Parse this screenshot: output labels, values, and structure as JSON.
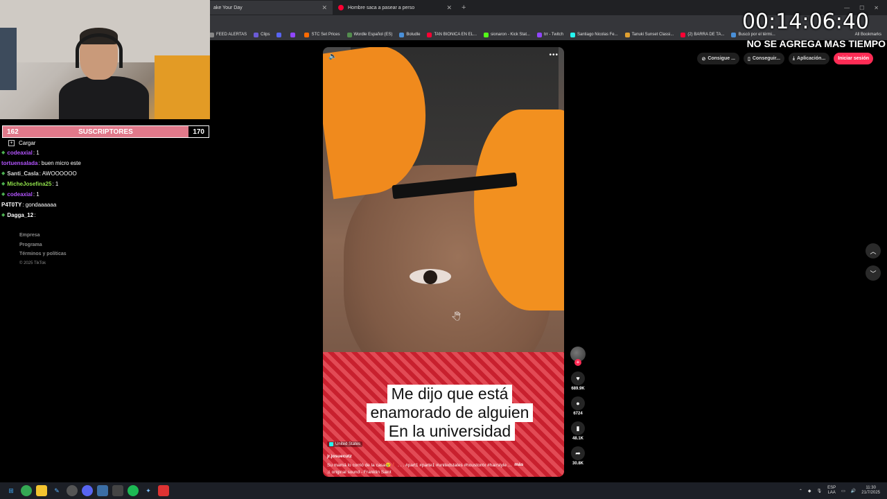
{
  "browser": {
    "tabs": [
      {
        "label": "ake Your Day",
        "active": true
      },
      {
        "label": "Hombre saca a pasear a perso",
        "active": false
      }
    ],
    "bookmarks": [
      {
        "label": "FEED ALERTAS",
        "color": "#888888"
      },
      {
        "label": "Clips",
        "color": "#6b5bd6"
      },
      {
        "label": "",
        "color": "#5865f2"
      },
      {
        "label": "",
        "color": "#9146ff"
      },
      {
        "label": "STC Set Prices",
        "color": "#ff6a00"
      },
      {
        "label": "Wordle Español (ES)",
        "color": "#538d4e"
      },
      {
        "label": "Boludle",
        "color": "#4a90d9"
      },
      {
        "label": "TAN BIONICA EN EL...",
        "color": "#ff0033"
      },
      {
        "label": "sionaron - Kick Stat...",
        "color": "#53fc18"
      },
      {
        "label": "trr - Twitch",
        "color": "#9146ff"
      },
      {
        "label": "Santiago Nicolas Fe...",
        "color": "#25f4ee"
      },
      {
        "label": "Tanuki Sunset Classi...",
        "color": "#e0a030"
      },
      {
        "label": "(2) BARRA DE TA...",
        "color": "#ff0033"
      },
      {
        "label": "Buscó por el térmi...",
        "color": "#4a90d9"
      }
    ],
    "all_bookmarks": "All Bookmarks"
  },
  "overlay": {
    "timer": "00:14:06:40",
    "timer_note": "NO SE AGREGA MAS TIEMPO"
  },
  "subs": {
    "current": "162",
    "label": "SUSCRIPTORES",
    "goal": "170"
  },
  "chat": {
    "load_label": "Cargar",
    "messages": [
      {
        "user": "codeaxial",
        "text": ": 1",
        "color": "#b455ff",
        "diamond": true
      },
      {
        "user": "tortuensalada",
        "text": ": buen micro este",
        "color": "#b455ff",
        "diamond": false
      },
      {
        "user": "Santi_Casla",
        "text": ": AWOOOOOO",
        "color": "#dddddd",
        "diamond": true
      },
      {
        "user": "MicheJosefina25",
        "text": ": 1",
        "color": "#8fe04a",
        "diamond": true
      },
      {
        "user": "codeaxial",
        "text": ": 1",
        "color": "#b455ff",
        "diamond": true
      },
      {
        "user": "P4T0TY",
        "text": ": gondaaaaaa",
        "color": "#ffffff",
        "diamond": false
      },
      {
        "user": "Dagga_12",
        "text": ":",
        "color": "#ffffff",
        "diamond": true
      }
    ]
  },
  "tiktok": {
    "top": {
      "btn1": "Consigue ...",
      "btn2": "Conseguir...",
      "btn3": "Aplicación...",
      "login": "Iniciar sesión"
    },
    "footer": [
      "Empresa",
      "Programa",
      "Términos y políticas"
    ],
    "copyright": "© 2025 TikTok",
    "video": {
      "caption_lines": [
        "Me dijo que está",
        "enamorado de alguien",
        "En la universidad"
      ],
      "location": "United States",
      "username": "jr.josuecutz",
      "description": "Su mamá lo corrió de la casa😢❗ . . . #part1 #parte1 #unitedstates #houstontx #hairstyle ...",
      "more": "más",
      "sound": "♫ original sound - Franklin Saint"
    },
    "actions": {
      "likes": "689.9K",
      "comments": "6724",
      "saves": "48.1K",
      "shares": "30.8K"
    }
  },
  "taskbar": {
    "lang": "ESP",
    "lang2": "LAA",
    "time": "11:30",
    "date": "21/7/2025"
  }
}
